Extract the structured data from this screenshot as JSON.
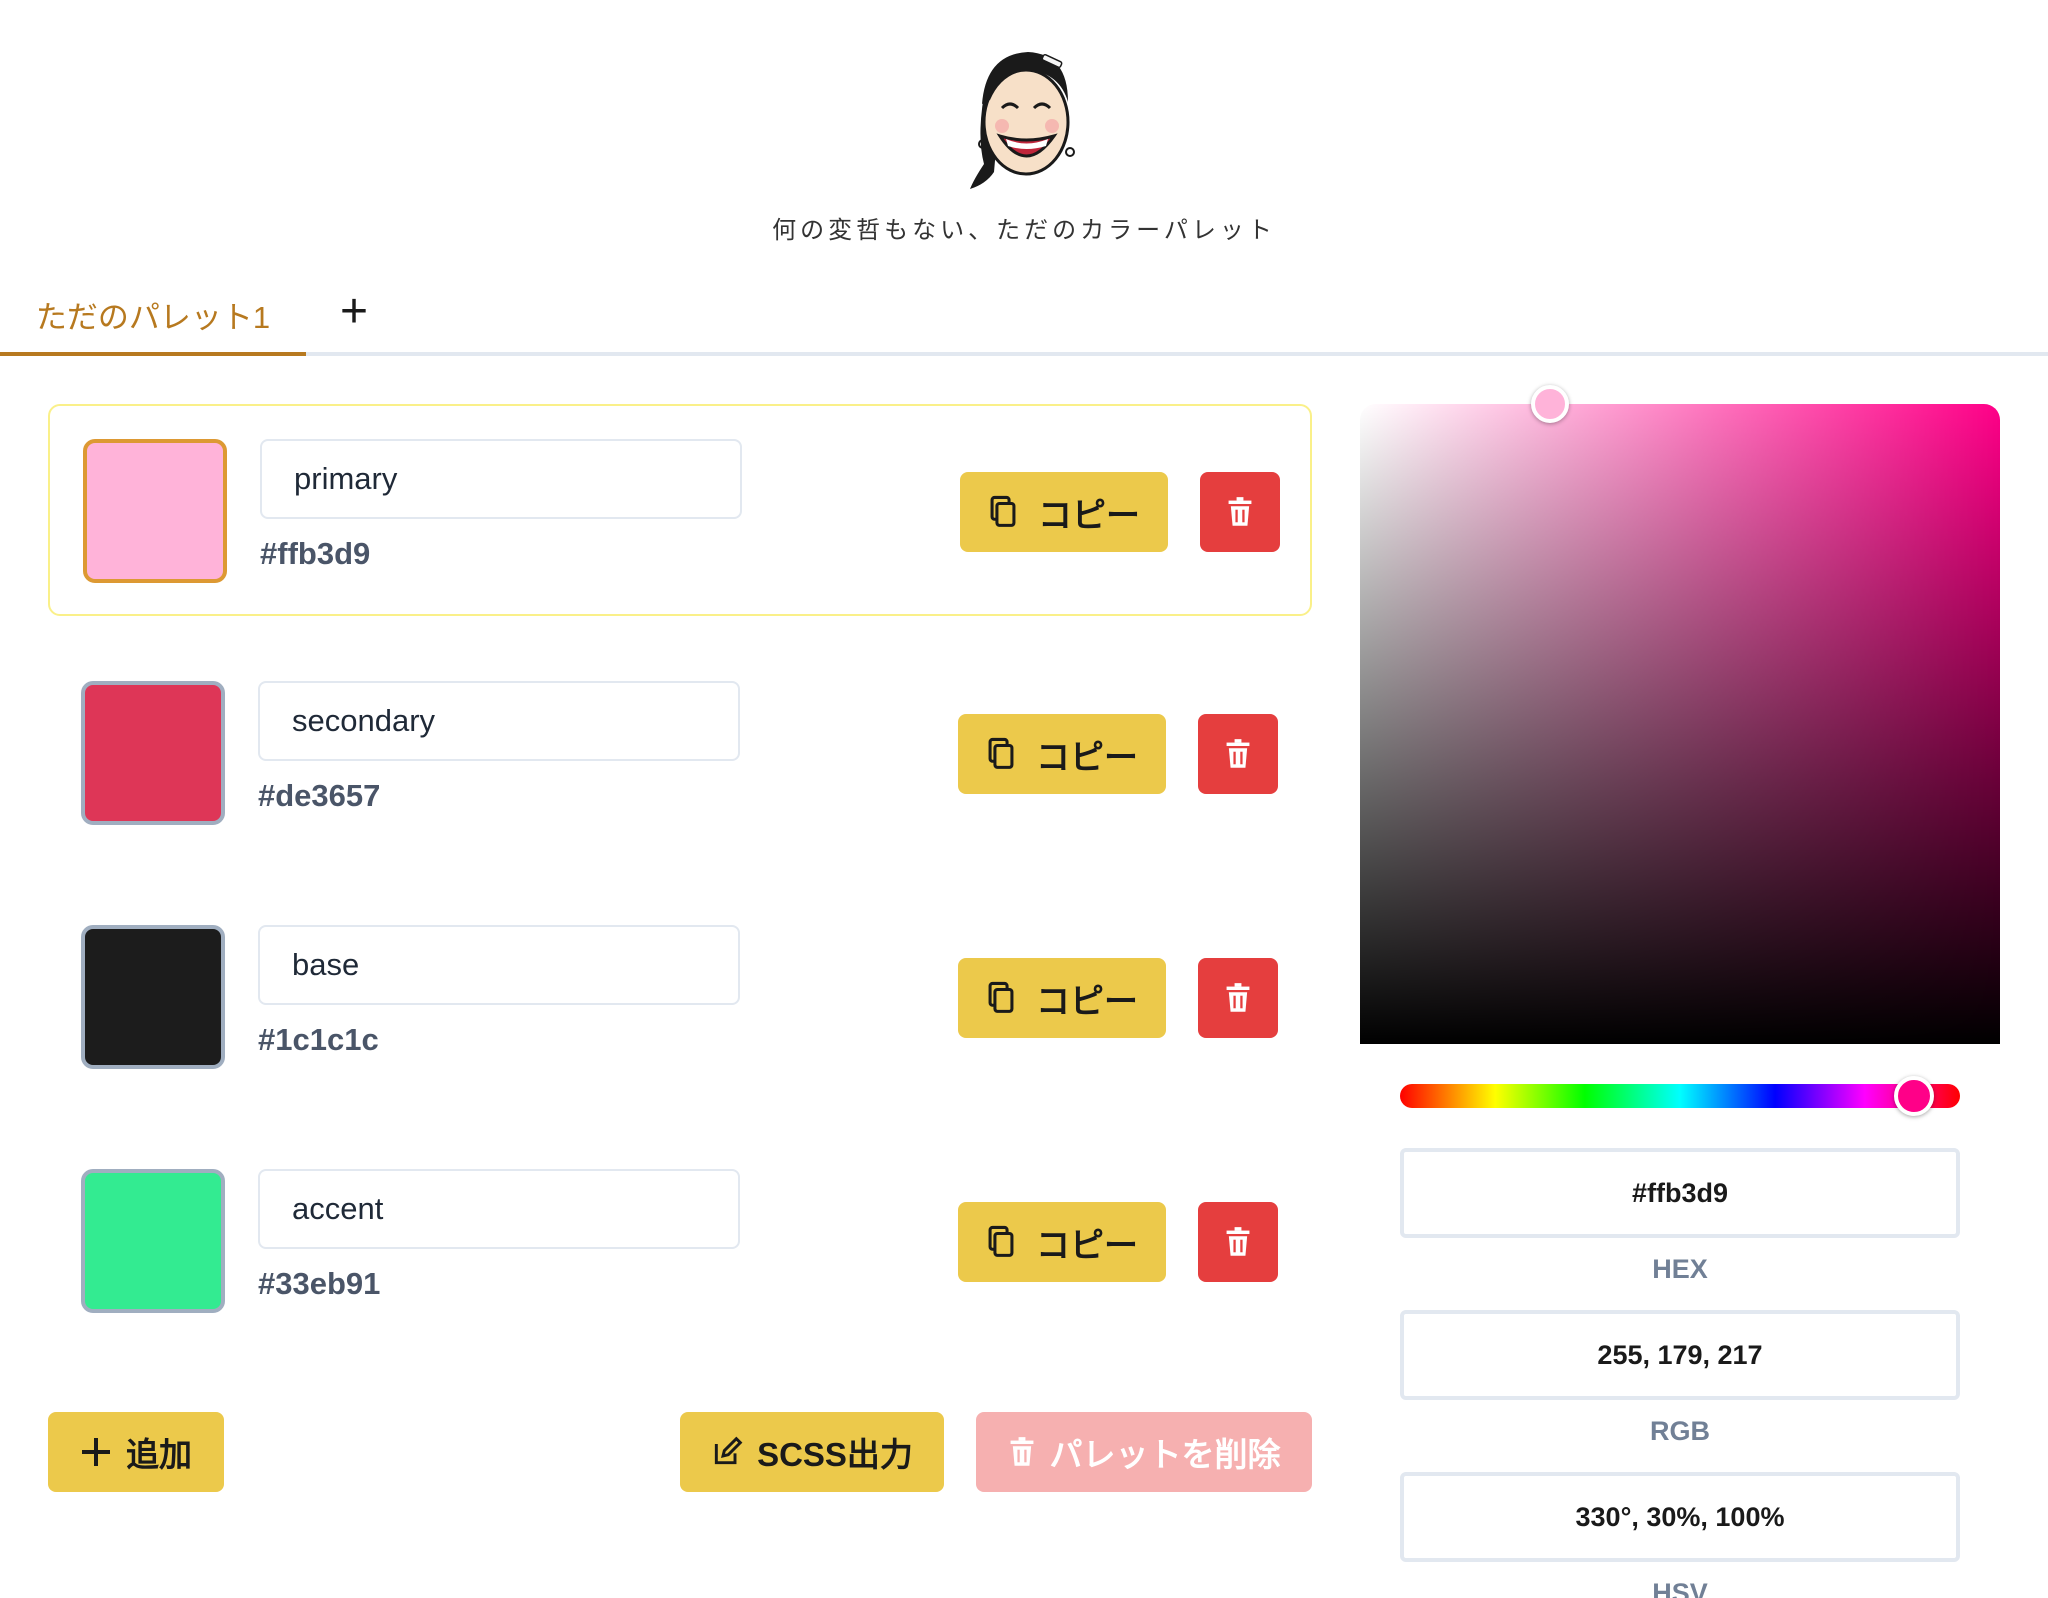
{
  "header": {
    "tagline": "何の変哲もない、ただのカラーパレット"
  },
  "tabs": [
    {
      "label": "ただのパレット1",
      "active": true
    }
  ],
  "add_tab_label": "+",
  "colors": [
    {
      "name": "primary",
      "hex": "#ffb3d9",
      "selected": true
    },
    {
      "name": "secondary",
      "hex": "#de3657",
      "selected": false
    },
    {
      "name": "base",
      "hex": "#1c1c1c",
      "selected": false
    },
    {
      "name": "accent",
      "hex": "#33eb91",
      "selected": false
    }
  ],
  "row_buttons": {
    "copy_label": "コピー"
  },
  "footer": {
    "add_label": "追加",
    "scss_label": "SCSS出力",
    "delete_palette_label": "パレットを削除"
  },
  "picker": {
    "hue_color": "#ff0088",
    "hex_value": "#ffb3d9",
    "hex_label": "HEX",
    "rgb_value": "255, 179, 217",
    "rgb_label": "RGB",
    "hsv_value": "330°, 30%, 100%",
    "hsv_label": "HSV"
  },
  "accent_colors": {
    "tab_active": "#b7791f",
    "button_yellow": "#ecc94b",
    "button_red": "#e53e3e",
    "button_red_disabled": "#f6b0b0"
  }
}
